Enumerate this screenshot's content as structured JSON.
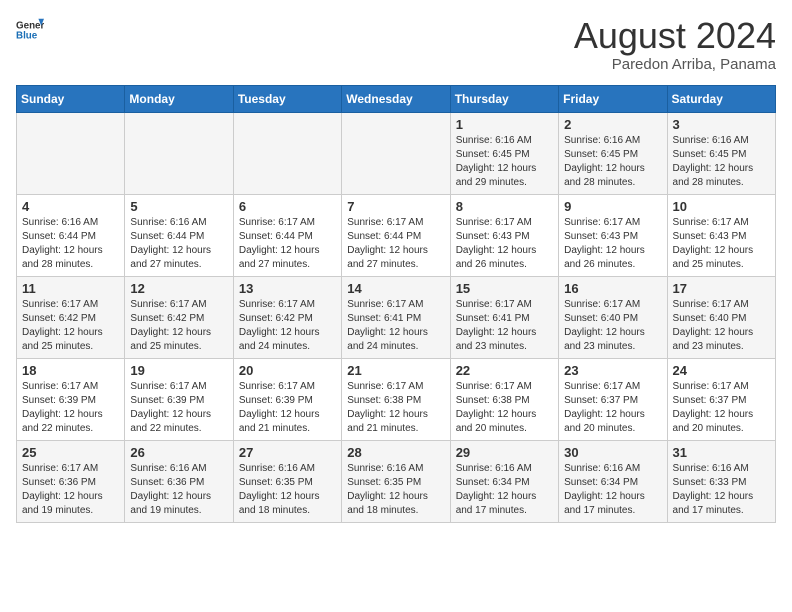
{
  "header": {
    "logo_general": "General",
    "logo_blue": "Blue",
    "month_year": "August 2024",
    "location": "Paredon Arriba, Panama"
  },
  "days_of_week": [
    "Sunday",
    "Monday",
    "Tuesday",
    "Wednesday",
    "Thursday",
    "Friday",
    "Saturday"
  ],
  "weeks": [
    [
      {
        "day": "",
        "info": ""
      },
      {
        "day": "",
        "info": ""
      },
      {
        "day": "",
        "info": ""
      },
      {
        "day": "",
        "info": ""
      },
      {
        "day": "1",
        "info": "Sunrise: 6:16 AM\nSunset: 6:45 PM\nDaylight: 12 hours\nand 29 minutes."
      },
      {
        "day": "2",
        "info": "Sunrise: 6:16 AM\nSunset: 6:45 PM\nDaylight: 12 hours\nand 28 minutes."
      },
      {
        "day": "3",
        "info": "Sunrise: 6:16 AM\nSunset: 6:45 PM\nDaylight: 12 hours\nand 28 minutes."
      }
    ],
    [
      {
        "day": "4",
        "info": "Sunrise: 6:16 AM\nSunset: 6:44 PM\nDaylight: 12 hours\nand 28 minutes."
      },
      {
        "day": "5",
        "info": "Sunrise: 6:16 AM\nSunset: 6:44 PM\nDaylight: 12 hours\nand 27 minutes."
      },
      {
        "day": "6",
        "info": "Sunrise: 6:17 AM\nSunset: 6:44 PM\nDaylight: 12 hours\nand 27 minutes."
      },
      {
        "day": "7",
        "info": "Sunrise: 6:17 AM\nSunset: 6:44 PM\nDaylight: 12 hours\nand 27 minutes."
      },
      {
        "day": "8",
        "info": "Sunrise: 6:17 AM\nSunset: 6:43 PM\nDaylight: 12 hours\nand 26 minutes."
      },
      {
        "day": "9",
        "info": "Sunrise: 6:17 AM\nSunset: 6:43 PM\nDaylight: 12 hours\nand 26 minutes."
      },
      {
        "day": "10",
        "info": "Sunrise: 6:17 AM\nSunset: 6:43 PM\nDaylight: 12 hours\nand 25 minutes."
      }
    ],
    [
      {
        "day": "11",
        "info": "Sunrise: 6:17 AM\nSunset: 6:42 PM\nDaylight: 12 hours\nand 25 minutes."
      },
      {
        "day": "12",
        "info": "Sunrise: 6:17 AM\nSunset: 6:42 PM\nDaylight: 12 hours\nand 25 minutes."
      },
      {
        "day": "13",
        "info": "Sunrise: 6:17 AM\nSunset: 6:42 PM\nDaylight: 12 hours\nand 24 minutes."
      },
      {
        "day": "14",
        "info": "Sunrise: 6:17 AM\nSunset: 6:41 PM\nDaylight: 12 hours\nand 24 minutes."
      },
      {
        "day": "15",
        "info": "Sunrise: 6:17 AM\nSunset: 6:41 PM\nDaylight: 12 hours\nand 23 minutes."
      },
      {
        "day": "16",
        "info": "Sunrise: 6:17 AM\nSunset: 6:40 PM\nDaylight: 12 hours\nand 23 minutes."
      },
      {
        "day": "17",
        "info": "Sunrise: 6:17 AM\nSunset: 6:40 PM\nDaylight: 12 hours\nand 23 minutes."
      }
    ],
    [
      {
        "day": "18",
        "info": "Sunrise: 6:17 AM\nSunset: 6:39 PM\nDaylight: 12 hours\nand 22 minutes."
      },
      {
        "day": "19",
        "info": "Sunrise: 6:17 AM\nSunset: 6:39 PM\nDaylight: 12 hours\nand 22 minutes."
      },
      {
        "day": "20",
        "info": "Sunrise: 6:17 AM\nSunset: 6:39 PM\nDaylight: 12 hours\nand 21 minutes."
      },
      {
        "day": "21",
        "info": "Sunrise: 6:17 AM\nSunset: 6:38 PM\nDaylight: 12 hours\nand 21 minutes."
      },
      {
        "day": "22",
        "info": "Sunrise: 6:17 AM\nSunset: 6:38 PM\nDaylight: 12 hours\nand 20 minutes."
      },
      {
        "day": "23",
        "info": "Sunrise: 6:17 AM\nSunset: 6:37 PM\nDaylight: 12 hours\nand 20 minutes."
      },
      {
        "day": "24",
        "info": "Sunrise: 6:17 AM\nSunset: 6:37 PM\nDaylight: 12 hours\nand 20 minutes."
      }
    ],
    [
      {
        "day": "25",
        "info": "Sunrise: 6:17 AM\nSunset: 6:36 PM\nDaylight: 12 hours\nand 19 minutes."
      },
      {
        "day": "26",
        "info": "Sunrise: 6:16 AM\nSunset: 6:36 PM\nDaylight: 12 hours\nand 19 minutes."
      },
      {
        "day": "27",
        "info": "Sunrise: 6:16 AM\nSunset: 6:35 PM\nDaylight: 12 hours\nand 18 minutes."
      },
      {
        "day": "28",
        "info": "Sunrise: 6:16 AM\nSunset: 6:35 PM\nDaylight: 12 hours\nand 18 minutes."
      },
      {
        "day": "29",
        "info": "Sunrise: 6:16 AM\nSunset: 6:34 PM\nDaylight: 12 hours\nand 17 minutes."
      },
      {
        "day": "30",
        "info": "Sunrise: 6:16 AM\nSunset: 6:34 PM\nDaylight: 12 hours\nand 17 minutes."
      },
      {
        "day": "31",
        "info": "Sunrise: 6:16 AM\nSunset: 6:33 PM\nDaylight: 12 hours\nand 17 minutes."
      }
    ]
  ]
}
